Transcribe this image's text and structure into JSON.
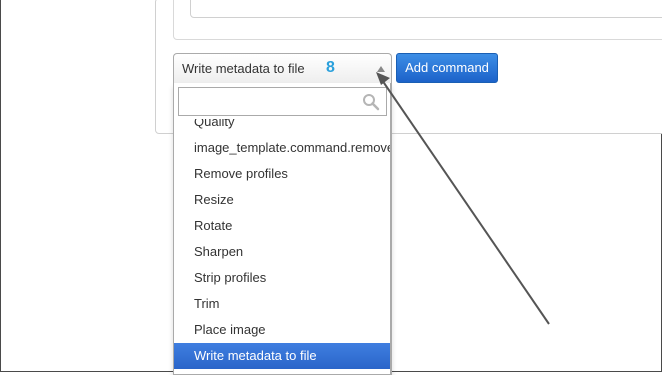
{
  "command_select": {
    "selected_label": "Write metadata to file",
    "badge": "8"
  },
  "add_command_button": {
    "label": "Add command"
  },
  "dropdown": {
    "search_placeholder": "",
    "options": [
      {
        "label": "Quality"
      },
      {
        "label": "image_template.command.remove"
      },
      {
        "label": "Remove profiles"
      },
      {
        "label": "Resize"
      },
      {
        "label": "Rotate"
      },
      {
        "label": "Sharpen"
      },
      {
        "label": "Strip profiles"
      },
      {
        "label": "Trim"
      },
      {
        "label": "Place image"
      },
      {
        "label": "Write metadata to file"
      }
    ],
    "selected_index": 9
  },
  "icons": {
    "search": "search-icon",
    "caret": "caret-up-icon"
  },
  "colors": {
    "button_bg": "#1c62c9",
    "selected_option_bg": "#3f7ee0",
    "badge": "#2aa0dc"
  }
}
